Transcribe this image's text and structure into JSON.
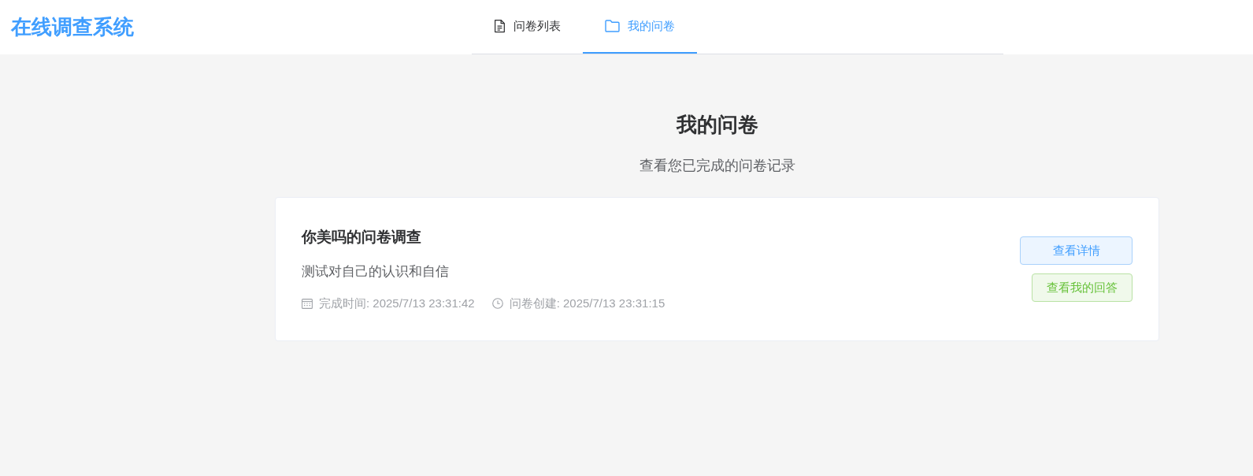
{
  "header": {
    "logo": "在线调查系统"
  },
  "nav_tabs": [
    {
      "label": "问卷列表",
      "selected": false
    },
    {
      "label": "我的问卷",
      "selected": true
    }
  ],
  "page": {
    "title": "我的问卷",
    "subtitle": "查看您已完成的问卷记录"
  },
  "surveys": [
    {
      "title": "你美吗的问卷调查",
      "description": "测试对自己的认识和自信",
      "meta": [
        {
          "kind": "completed",
          "text": "完成时间: 2025/7/13 23:31:42"
        },
        {
          "kind": "created",
          "text": "问卷创建: 2025/7/13 23:31:15"
        }
      ],
      "buttons": [
        {
          "kind": "primary",
          "label": "查看详情"
        },
        {
          "kind": "success",
          "label": "查看我的回答"
        }
      ]
    }
  ]
}
